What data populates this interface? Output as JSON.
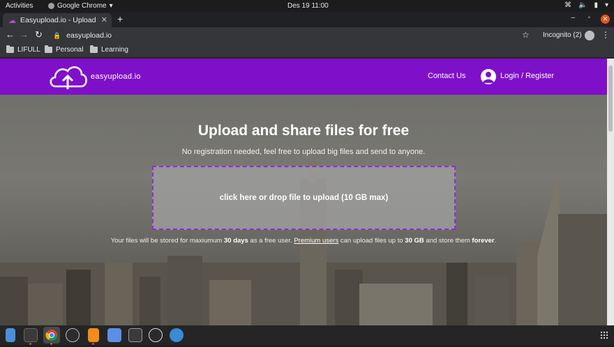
{
  "system": {
    "activities": "Activities",
    "app_name": "Google Chrome",
    "app_caret": "▾",
    "clock": "Des 19  11:00",
    "tray_network": "⌘",
    "tray_volume": "🔈",
    "tray_battery": "▮",
    "tray_caret": "▾"
  },
  "browser": {
    "tab_title": "Easyupload.io - Upload fi",
    "tab_close": "✕",
    "new_tab": "+",
    "url": "easyupload.io",
    "incognito": "Incognito (2)",
    "back": "←",
    "forward": "→",
    "reload": "↻",
    "star": "☆",
    "menu": "⋮",
    "win_min": "–",
    "win_max": "▫",
    "win_close": "✕",
    "bookmarks": [
      "LIFULL",
      "Personal",
      "Learning"
    ]
  },
  "site": {
    "logo_text": "easyupload.io",
    "nav_contact": "Contact Us",
    "nav_login": "Login / Register",
    "hero_title": "Upload and share files for free",
    "hero_subtitle": "No registration needed, feel free to upload big files and send to anyone.",
    "dropzone_label": "click here or drop file to upload (10 GB max)",
    "note_part1": "Your files will be stored for maxiumum ",
    "note_days": "30 days",
    "note_part2": " as a free user. ",
    "note_premium": "Premium users",
    "note_part3": " can upload files up to ",
    "note_size": "30 GB",
    "note_part4": " and store them ",
    "note_forever": "forever",
    "note_end": "."
  },
  "colors": {
    "header_purple": "#7f10c9",
    "dropzone_border": "#8d2fd6",
    "chrome_dark": "#35363a"
  },
  "dock": {
    "apps": [
      "files-app",
      "terminal-app",
      "chrome-app",
      "inkscape-app",
      "sublime-app",
      "docs-app",
      "reader-app",
      "obs-app",
      "chromium-app"
    ]
  }
}
